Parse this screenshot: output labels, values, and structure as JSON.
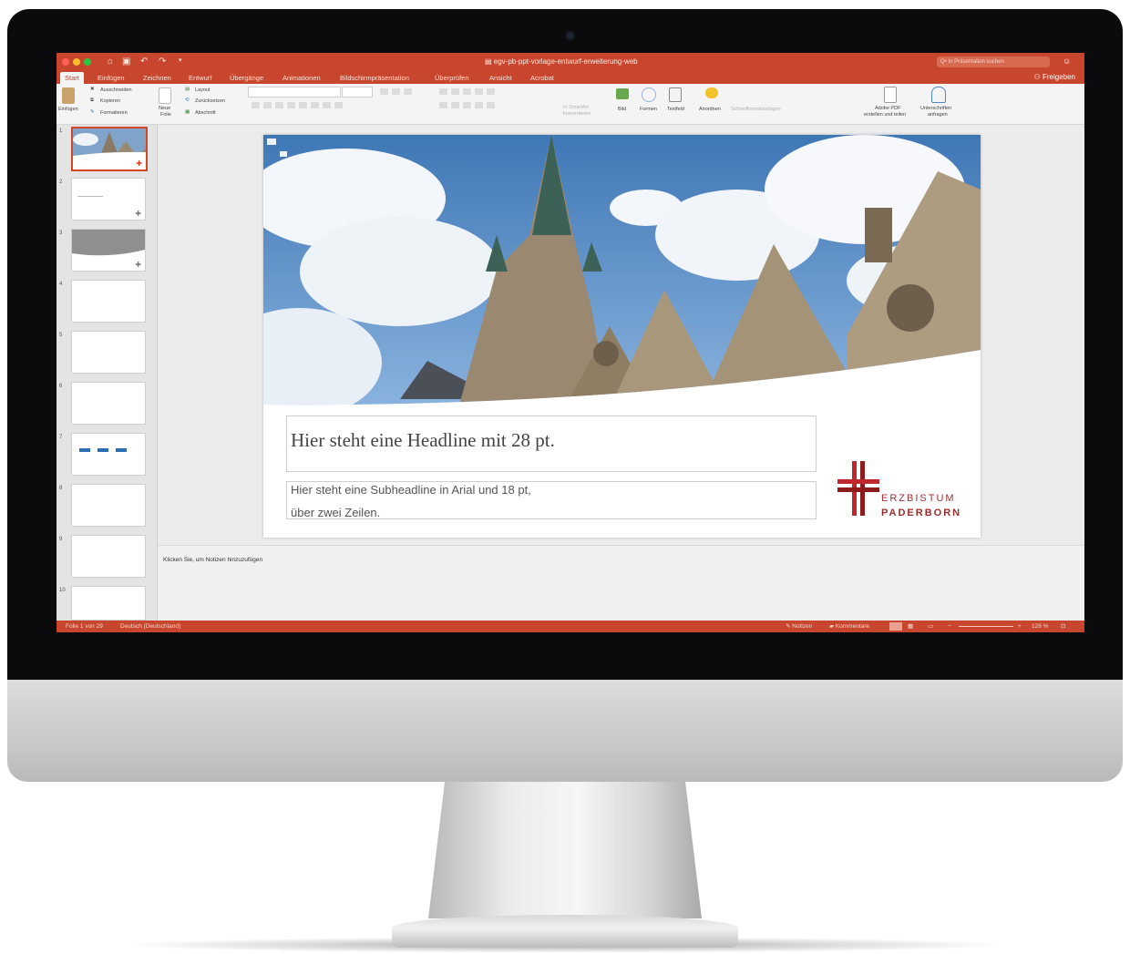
{
  "window": {
    "title": "egv-pb-ppt-vorlage-entwurf-erweiterung-web",
    "search_placeholder": "Q• In Präsentation suchen",
    "share_label": "Freigeben"
  },
  "tabs": [
    "Start",
    "Einfügen",
    "Zeichnen",
    "Entwurf",
    "Übergänge",
    "Animationen",
    "Bildschirmpräsentation",
    "Überprüfen",
    "Ansicht",
    "Acrobat"
  ],
  "ribbon": {
    "paste": "Einfügen",
    "cut": "Ausschneiden",
    "copy": "Kopieren",
    "format": "Formatieren",
    "new_slide_1": "Neue",
    "new_slide_2": "Folie",
    "layout": "Layout",
    "reset": "Zurücksetzen",
    "section": "Abschnitt",
    "convert_smartart_1": "In SmartArt",
    "convert_smartart_2": "konvertieren",
    "picture": "Bild",
    "shapes": "Formen",
    "textbox": "Textfeld",
    "arrange": "Anordnen",
    "quick_styles": "Schnellformatvorlagen",
    "adobe_pdf_1": "Adobe PDF",
    "adobe_pdf_2": "erstellen und teilen",
    "signatures_1": "Unterschriften",
    "signatures_2": "anfragen"
  },
  "thumbnails": [
    "1",
    "2",
    "3",
    "4",
    "5",
    "6",
    "7",
    "8",
    "9",
    "10"
  ],
  "slide": {
    "headline": "Hier steht eine Headline mit 28 pt.",
    "sub_line1": "Hier steht eine Subheadline in Arial und 18 pt,",
    "sub_line2": "über zwei Zeilen.",
    "logo_line1": "ERZBISTUM",
    "logo_line2": "PADERBORN"
  },
  "notes_placeholder": "Klicken Sie, um Notizen hinzuzufügen",
  "status": {
    "slide_info": "Folie 1 von 29",
    "language": "Deutsch (Deutschland)",
    "notes": "Notizen",
    "comments": "Kommentare",
    "zoom": "128 %"
  },
  "colors": {
    "accent": "#c8462d",
    "logo_red": "#c0272d",
    "logo_dark": "#8e1b1b"
  }
}
